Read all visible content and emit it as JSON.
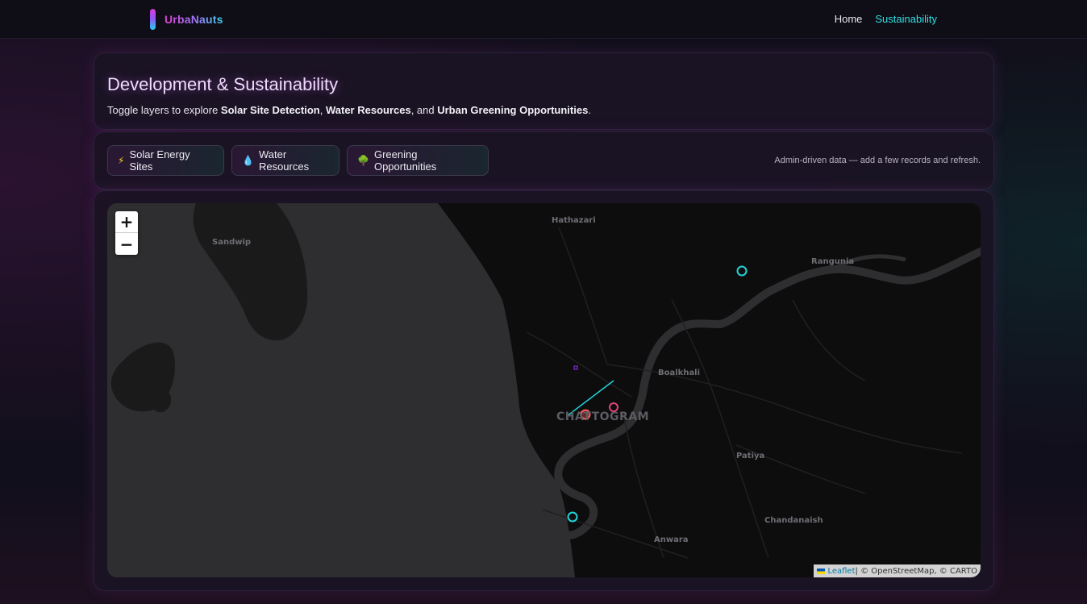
{
  "nav": {
    "brand": "UrbaNauts",
    "links": [
      {
        "label": "Home",
        "active": false
      },
      {
        "label": "Sustainability",
        "active": true
      }
    ]
  },
  "hero": {
    "title": "Development & Sustainability",
    "subtitle_prefix": "Toggle layers to explore ",
    "subtitle_b1": "Solar Site Detection",
    "subtitle_sep1": ", ",
    "subtitle_b2": "Water Resources",
    "subtitle_sep2": ", and ",
    "subtitle_b3": "Urban Greening Opportunities",
    "subtitle_suffix": "."
  },
  "controls": {
    "layers": [
      {
        "icon": "lightning-icon",
        "glyph": "⚡",
        "label": "Solar Energy Sites"
      },
      {
        "icon": "water-drop-icon",
        "glyph": "💧",
        "label": "Water Resources"
      },
      {
        "icon": "tree-icon",
        "glyph": "🌳",
        "label": "Greening Opportunities"
      }
    ],
    "note": "Admin-driven data — add a few records and refresh."
  },
  "map": {
    "zoom_in": "+",
    "zoom_out": "−",
    "places": [
      "Hathazari",
      "Sandwip",
      "Rangunia",
      "Boalkhali",
      "CHATTOGRAM",
      "Patiya",
      "Chandanaish",
      "Anwara"
    ],
    "attribution_link": "Leaflet",
    "attribution_text": " | © OpenStreetMap, © CARTO",
    "colors": {
      "water": "#2e2e30",
      "land": "#0d0d0e",
      "cyan_marker": "#22d3d6",
      "red_marker": "#ff5c5c",
      "pink_marker": "#e8437a",
      "purple_marker": "#9b30ff"
    }
  }
}
